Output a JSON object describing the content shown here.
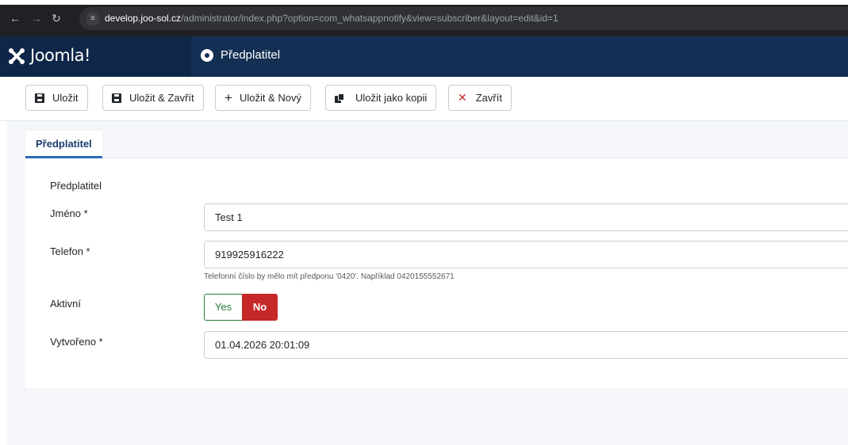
{
  "browser": {
    "url_host": "develop.joo-sol.cz",
    "url_path": "/administrator/index.php?option=com_whatsappnotify&view=subscriber&layout=edit&id=1",
    "icons": [
      "arrow-left-icon",
      "arrow-right-icon",
      "reload-icon",
      "site-info-icon"
    ]
  },
  "header": {
    "logo_text": "Joomla!",
    "title": "Předplatitel"
  },
  "toolbar": {
    "save_label": "Uložit",
    "save_close_label": "Uložit & Zavřít",
    "save_new_label": "Uložit & Nový",
    "save_copy_label": "Uložit jako kopii",
    "close_label": "Zavřít"
  },
  "tabs": [
    {
      "label": "Předplatitel",
      "active": true
    }
  ],
  "form": {
    "legend": "Předplatitel",
    "name": {
      "label": "Jméno *",
      "value": "Test 1"
    },
    "phone": {
      "label": "Telefon *",
      "value": "919925916222",
      "hint": "Telefonní číslo by mělo mít předponu '0420'. Například 0420155552671"
    },
    "active": {
      "label": "Aktivní",
      "yes_label": "Yes",
      "no_label": "No",
      "selected": "No"
    },
    "created": {
      "label": "Vytvořeno *",
      "value": "01.04.2026 20:01:09"
    }
  },
  "colors": {
    "header_bg": "#132f53",
    "logo_bg": "#0e2647",
    "toggle_no": "#c52827",
    "toggle_yes": "#2a7a3c",
    "close_icon": "#c52827"
  }
}
